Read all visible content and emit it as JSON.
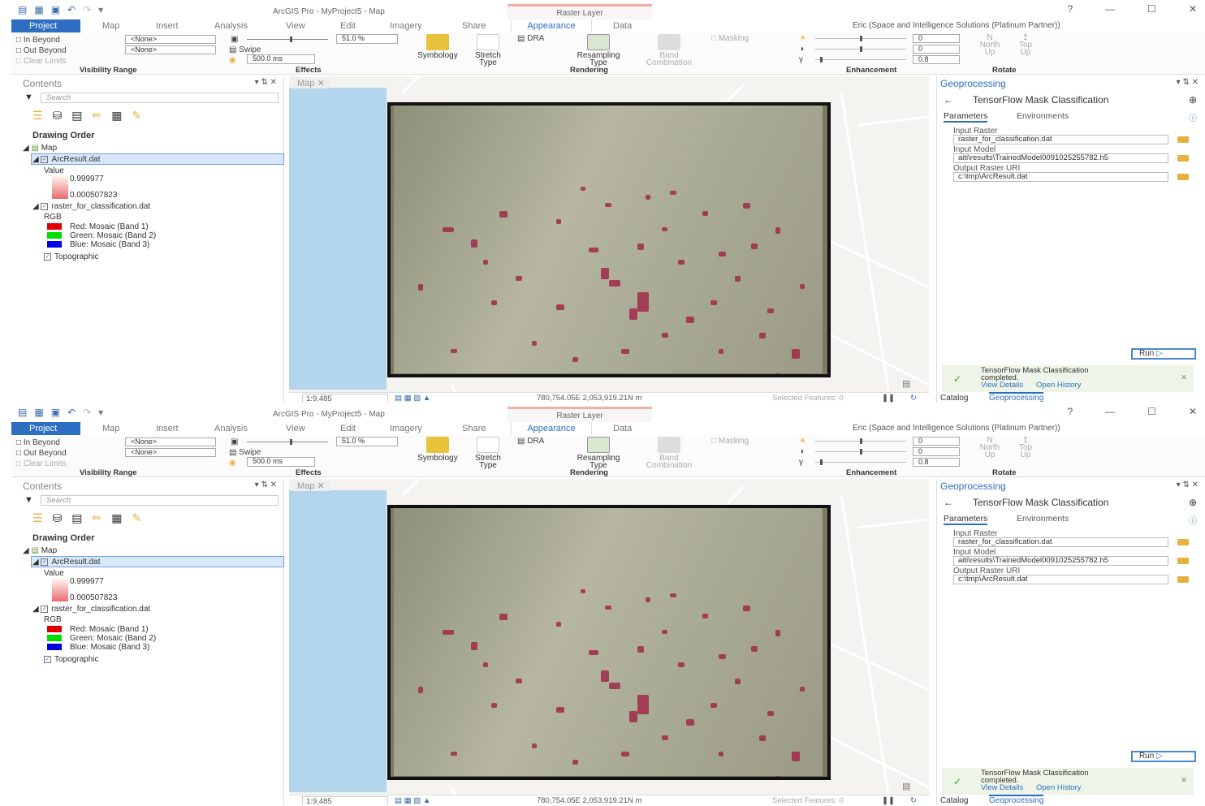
{
  "window": {
    "app_title": "ArcGIS Pro - MyProject5 - Map",
    "context_tab": "Raster Layer",
    "user": "Eric (Space and Intelligence Solutions (Platinum Partner))",
    "help": "?",
    "minimize": "—",
    "maximize": "☐",
    "close": "✕"
  },
  "tabs": [
    "Project",
    "Map",
    "Insert",
    "Analysis",
    "View",
    "Edit",
    "Imagery",
    "Share",
    "Appearance",
    "Data"
  ],
  "ribbon": {
    "visibility": {
      "in_beyond": "In Beyond",
      "out_beyond": "Out Beyond",
      "clear_limits": "Clear Limits",
      "none": "<None>",
      "group": "Visibility Range"
    },
    "effects": {
      "transparency": "51.0  %",
      "swipe": "Swipe",
      "flicker": "500.0  ms",
      "group": "Effects"
    },
    "symbology": "Symbology",
    "stretch": "Stretch",
    "stretch_type": "Type",
    "dra": "DRA",
    "resampling": "Resampling",
    "resampling_type": "Type",
    "band": "Band",
    "band_combination": "Combination",
    "masking": "Masking",
    "rendering_group": "Rendering",
    "enhancement": {
      "v1": "0",
      "v2": "0",
      "v3": "0.8",
      "group": "Enhancement"
    },
    "rotate": {
      "north": "North",
      "up": "Up",
      "top": "Top",
      "group": "Rotate",
      "n": "N"
    }
  },
  "contents": {
    "title": "Contents",
    "search_placeholder": "Search",
    "drawing_order": "Drawing Order",
    "map": "Map",
    "layer1": "ArcResult.dat",
    "value": "Value",
    "max": "0.999977",
    "min": "0.000507823",
    "layer2": "raster_for_classification.dat",
    "rgb": "RGB",
    "red": "Red:   Mosaic (Band 1)",
    "green": "Green: Mosaic (Band 2)",
    "blue": "Blue:  Mosaic (Band 3)",
    "topo": "Topographic",
    "red_color": "#e00000",
    "green_color": "#00dd00",
    "blue_color": "#0000e0"
  },
  "map": {
    "tab": "Map",
    "scale": "1:9,485",
    "coords": "780,754.05E 2,053,919.21N m",
    "selected": "Selected Features: 0"
  },
  "geo": {
    "title": "Geoprocessing",
    "tool": "TensorFlow Mask Classification",
    "parameters": "Parameters",
    "environments": "Environments",
    "input_raster_label": "Input Raster",
    "input_raster": "raster_for_classification.dat",
    "input_model_label": "Input Model",
    "input_model": "aiti\\results\\TrainedModel0091025255782.h5",
    "output_label": "Output Raster URI",
    "output": "c:\\tmp\\ArcResult.dat",
    "run": "Run",
    "completed_tool": "TensorFlow Mask Classification",
    "completed": "completed.",
    "view_details": "View Details",
    "open_history": "Open History",
    "catalog": "Catalog",
    "geoprocessing": "Geoprocessing"
  }
}
